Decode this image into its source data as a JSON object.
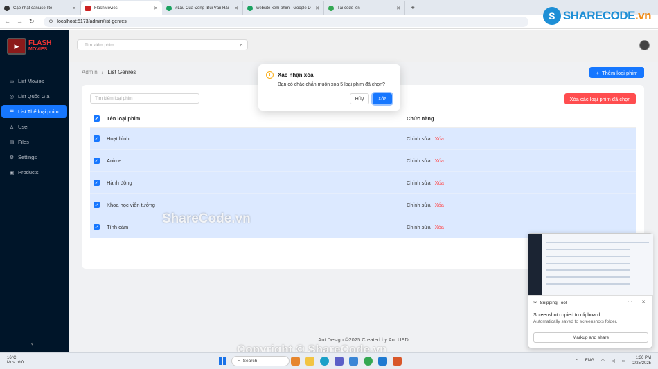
{
  "browser": {
    "tabs": [
      {
        "title": "Cập nhật caniuse-lite",
        "color": "#333333"
      },
      {
        "title": "FlashMovies",
        "color": "#cc2222",
        "active": true
      },
      {
        "title": "#Lẩu Cua Đồng_Bùi Văn Hải_Fi",
        "color": "#1aa260"
      },
      {
        "title": "website xem phim - Google D",
        "color": "#1aa260"
      },
      {
        "title": "Tải code lên",
        "color": "#34a853"
      }
    ],
    "new_tab": "+",
    "url": "localhost:5173/admin/list-genres"
  },
  "watermark_logo": {
    "letter": "S",
    "text_main": "SHARECODE",
    "text_suffix": ".vn"
  },
  "sidebar": {
    "brand_top": "FLASH",
    "brand_bottom": "MOVIES",
    "items": [
      {
        "label": "List Movies",
        "icon": "video-icon"
      },
      {
        "label": "List Quốc Gia",
        "icon": "globe-icon"
      },
      {
        "label": "List Thể loại phim",
        "icon": "list-icon",
        "selected": true
      },
      {
        "label": "User",
        "icon": "user-icon"
      },
      {
        "label": "Files",
        "icon": "file-icon"
      },
      {
        "label": "Settings",
        "icon": "gear-icon"
      },
      {
        "label": "Products",
        "icon": "box-icon"
      }
    ],
    "collapse": "‹"
  },
  "header": {
    "search_placeholder": "Tìm kiếm phim..."
  },
  "breadcrumb": {
    "root": "Admin",
    "sep": "/",
    "current": "List Genres"
  },
  "add_button": "Thêm loại phim",
  "filter_placeholder": "Tìm kiếm loại phim",
  "delete_selected": "Xóa các loại phim đã chọn",
  "table": {
    "col_name": "Tên loại phim",
    "col_action": "Chức năng",
    "edit_label": "Chỉnh sửa",
    "delete_label": "Xóa",
    "rows": [
      {
        "name": "Hoạt hình"
      },
      {
        "name": "Anime"
      },
      {
        "name": "Hành động"
      },
      {
        "name": "Khoa học viễn tưởng"
      },
      {
        "name": "Tình cảm"
      }
    ]
  },
  "footer": "Ant Design ©2025 Created by Ant UED",
  "modal": {
    "title": "Xác nhận xóa",
    "body": "Bạn có chắc chắn muốn xóa 5 loại phim đã chọn?",
    "cancel": "Hủy",
    "ok": "Xóa"
  },
  "watermarks": {
    "center": "ShareCode.vn",
    "bottom": "Copyright © ShareCode.vn"
  },
  "snipping": {
    "app": "Snipping Tool",
    "line1": "Screenshot copied to clipboard",
    "line2": "Automatically saved to screenshots folder.",
    "action": "Markup and share"
  },
  "taskbar": {
    "weather_temp": "16°C",
    "weather_desc": "Mưa nhỏ",
    "search": "Search",
    "lang": "ENG",
    "time": "1:36 PM",
    "date": "2/25/2025"
  }
}
